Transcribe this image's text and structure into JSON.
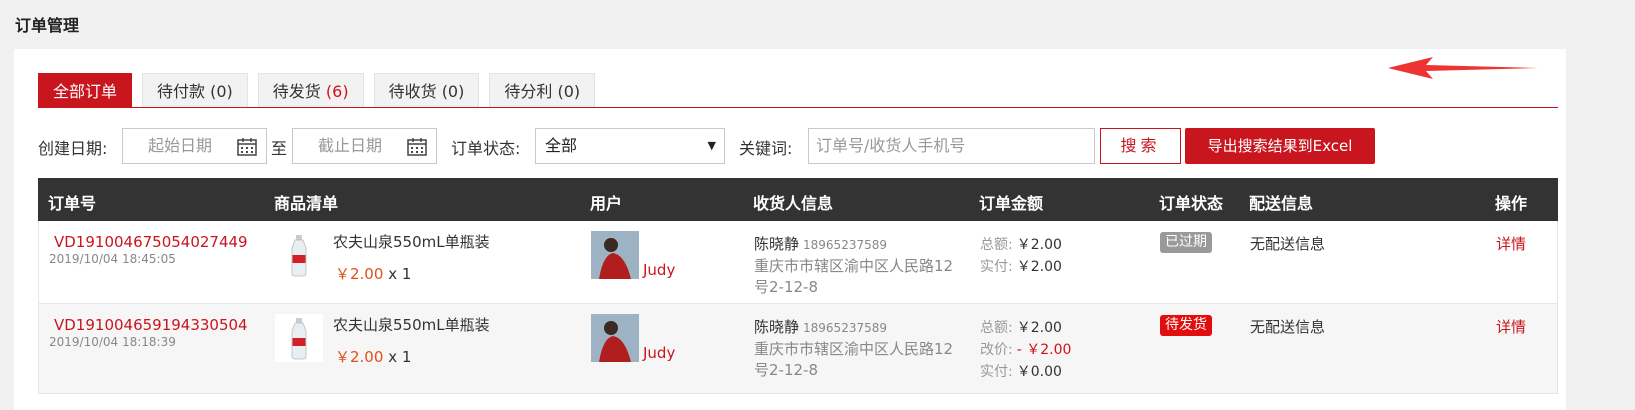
{
  "page_title": "订单管理",
  "tabs": [
    {
      "label": "全部订单",
      "count": ""
    },
    {
      "label": "待付款",
      "count": "(0)"
    },
    {
      "label": "待发货",
      "count": "(6)"
    },
    {
      "label": "待收货",
      "count": "(0)"
    },
    {
      "label": "待分利",
      "count": "(0)"
    }
  ],
  "filters": {
    "create_date_label": "创建日期:",
    "start_placeholder": "起始日期",
    "to_label": "至",
    "end_placeholder": "截止日期",
    "status_label": "订单状态:",
    "status_value": "全部",
    "keyword_label": "关键词:",
    "keyword_placeholder": "订单号/收货人手机号",
    "search_label": "搜索",
    "export_label": "导出搜索结果到Excel"
  },
  "columns": [
    "订单号",
    "商品清单",
    "用户",
    "收货人信息",
    "订单金额",
    "订单状态",
    "配送信息",
    "操作"
  ],
  "orders": [
    {
      "order_no": "VD191004675054027449",
      "time": "2019/10/04 18:45:05",
      "product_name": "农夫山泉550mL单瓶装",
      "price": "￥2.00",
      "qty": "x 1",
      "user": "Judy",
      "receiver_name": "陈晓静",
      "receiver_phone": "18965237589",
      "address": "重庆市市辖区渝中区人民路12号2-12-8",
      "total_label": "总额:",
      "total": "￥2.00",
      "paid_label": "实付:",
      "paid": "￥2.00",
      "status": "已过期",
      "shipping": "无配送信息",
      "action": "详情"
    },
    {
      "order_no": "VD191004659194330504",
      "time": "2019/10/04 18:18:39",
      "product_name": "农夫山泉550mL单瓶装",
      "price": "￥2.00",
      "qty": "x 1",
      "user": "Judy",
      "receiver_name": "陈晓静",
      "receiver_phone": "18965237589",
      "address": "重庆市市辖区渝中区人民路12号2-12-8",
      "total_label": "总额:",
      "total": "￥2.00",
      "adjust_label": "改价:",
      "adjust": "- ￥2.00",
      "paid_label": "实付:",
      "paid": "￥0.00",
      "status": "待发货",
      "shipping": "无配送信息",
      "action": "详情"
    }
  ],
  "colors": {
    "accent": "#c9151e",
    "header_bg": "#333333",
    "price": "#e0501c",
    "status_expired": "#999999",
    "status_pending": "#e20d0d"
  }
}
